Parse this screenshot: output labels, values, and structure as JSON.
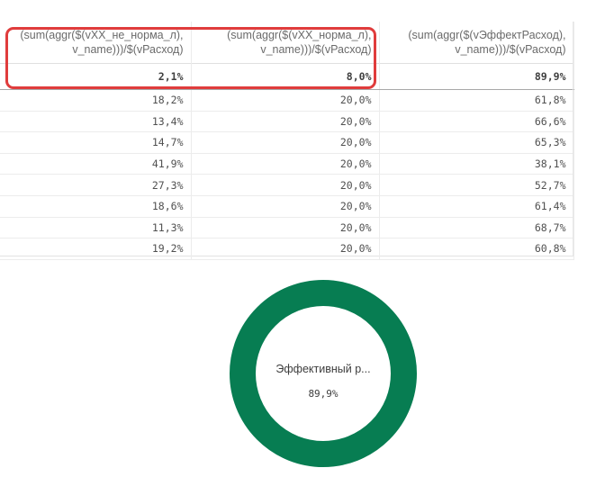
{
  "table": {
    "headers": [
      "(sum(aggr($(vXX_не_норма_л), v_name)))/$(vРасход)",
      "(sum(aggr($(vXX_норма_л), v_name)))/$(vРасход)",
      "(sum(aggr($(vЭффектРасход), v_name)))/$(vРасход)"
    ],
    "totals": [
      "2,1%",
      "8,0%",
      "89,9%"
    ],
    "rows": [
      [
        "18,2%",
        "20,0%",
        "61,8%"
      ],
      [
        "13,4%",
        "20,0%",
        "66,6%"
      ],
      [
        "14,7%",
        "20,0%",
        "65,3%"
      ],
      [
        "41,9%",
        "20,0%",
        "38,1%"
      ],
      [
        "27,3%",
        "20,0%",
        "52,7%"
      ],
      [
        "18,6%",
        "20,0%",
        "61,4%"
      ],
      [
        "11,3%",
        "20,0%",
        "68,7%"
      ],
      [
        "19,2%",
        "20,0%",
        "60,8%"
      ]
    ]
  },
  "highlight": {
    "color": "#e03c3c"
  },
  "kpi_donut": {
    "label": "Эффективный р...",
    "value_text": "89,9%",
    "value": 0.899,
    "color": "#077d52"
  }
}
